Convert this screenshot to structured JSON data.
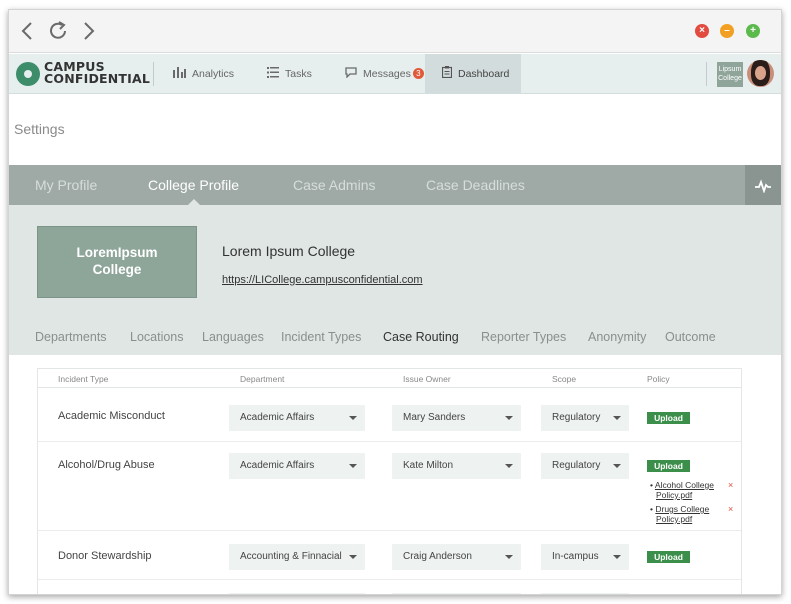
{
  "browser": {
    "back_icon": "arrow-left-icon",
    "reload_icon": "reload-icon",
    "forward_icon": "arrow-right-icon",
    "close": "×",
    "minimize": "–",
    "maximize": "+"
  },
  "app": {
    "logo_line1": "CAMPUS",
    "logo_line2": "CONFIDENTIAL",
    "nav": [
      {
        "label": "Analytics",
        "icon": "bar-chart-icon"
      },
      {
        "label": "Tasks",
        "icon": "list-icon"
      },
      {
        "label": "Messages",
        "icon": "chat-icon",
        "badge": "3"
      },
      {
        "label": "Dashboard",
        "icon": "clipboard-icon"
      }
    ],
    "school_thumb": "Lipsum College",
    "accent": "#3d8c6a"
  },
  "page": {
    "title": "Settings"
  },
  "tabs": [
    "My Profile",
    "College Profile",
    "Case Admins",
    "Case Deadlines"
  ],
  "active_tab": "College Profile",
  "profile": {
    "logo_text": "LoremIpsum College",
    "name": "Lorem Ipsum College",
    "url": "https://LICollege.campusconfidential.com"
  },
  "subtabs": [
    "Departments",
    "Locations",
    "Languages",
    "Incident Types",
    "Case Routing",
    "Reporter Types",
    "Anonymity",
    "Outcome"
  ],
  "active_subtab": "Case Routing",
  "table": {
    "headers": [
      "Incident Type",
      "Department",
      "Issue Owner",
      "Scope",
      "Policy"
    ],
    "upload_label": "Upload",
    "rows": [
      {
        "incident": "Academic Misconduct",
        "department": "Academic Affairs",
        "owner": "Mary Sanders",
        "scope": "Regulatory",
        "files": []
      },
      {
        "incident": "Alcohol/Drug Abuse",
        "department": "Academic Affairs",
        "owner": "Kate Milton",
        "scope": "Regulatory",
        "files": [
          {
            "line1": "Alcohol College",
            "line2": "Policy.pdf"
          },
          {
            "line1": "Drugs College",
            "line2": "Policy.pdf"
          }
        ]
      },
      {
        "incident": "Donor Stewardship",
        "department": "Accounting & Finnacial",
        "owner": "Craig Anderson",
        "scope": "In-campus",
        "files": []
      }
    ],
    "remove_symbol": "×",
    "bullet": "•"
  }
}
